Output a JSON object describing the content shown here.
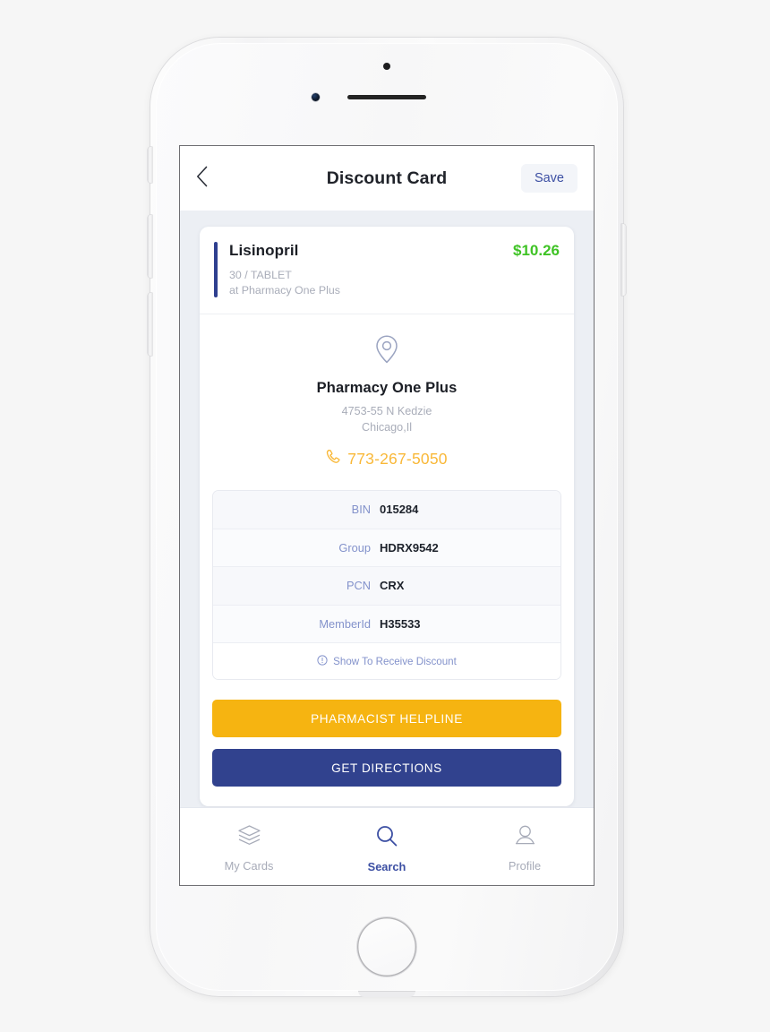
{
  "navbar": {
    "back_icon": "chevron-left-icon",
    "title": "Discount Card",
    "save_label": "Save"
  },
  "drug": {
    "name": "Lisinopril",
    "price": "$10.26",
    "quantity_form": "30 / TABLET",
    "at_pharmacy": "at Pharmacy One Plus",
    "price_color": "#3fc325",
    "accent_color": "#2e3f8f"
  },
  "pharmacy": {
    "pin_icon": "location-pin-icon",
    "name": "Pharmacy One Plus",
    "address_line1": "4753-55 N Kedzie",
    "address_line2": "Chicago,Il",
    "phone_icon": "phone-icon",
    "phone": "773-267-5050",
    "phone_color": "#f9b838"
  },
  "card_ids": {
    "rows": [
      {
        "label": "BIN",
        "value": "015284"
      },
      {
        "label": "Group",
        "value": "HDRX9542"
      },
      {
        "label": "PCN",
        "value": "CRX"
      },
      {
        "label": "MemberId",
        "value": "H35533"
      }
    ],
    "show_icon": "info-circle-icon",
    "show_label": "Show To Receive Discount"
  },
  "actions": {
    "helpline_label": "PHARMACIST HELPLINE",
    "helpline_color": "#f6b411",
    "directions_label": "GET DIRECTIONS",
    "directions_color": "#31428e"
  },
  "tabbar": {
    "tabs": [
      {
        "label": "My Cards",
        "icon": "layers-icon",
        "active": false
      },
      {
        "label": "Search",
        "icon": "search-icon",
        "active": true
      },
      {
        "label": "Profile",
        "icon": "person-icon",
        "active": false
      }
    ],
    "active_color": "#3c4fa3",
    "inactive_color": "#a7abb8"
  }
}
